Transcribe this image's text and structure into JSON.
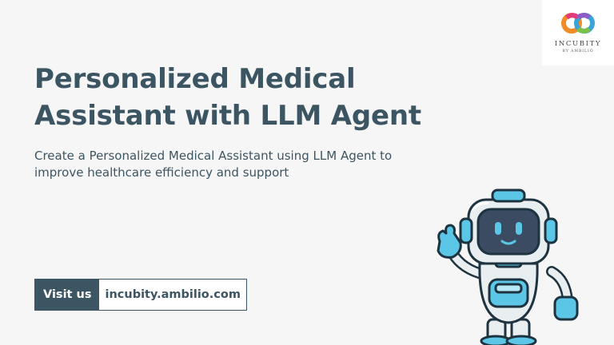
{
  "title": "Personalized Medical Assistant with LLM Agent",
  "subtitle": "Create a Personalized Medical Assistant using LLM Agent to improve healthcare efficiency and support",
  "cta": {
    "label": "Visit us",
    "url": "incubity.ambilio.com"
  },
  "logo": {
    "name": "INCUBITY",
    "tagline": "BY AMBILIO"
  },
  "illustration": {
    "name": "robot-mascot-waving-icon"
  },
  "colors": {
    "background": "#f6f6f6",
    "text": "#3c5563",
    "accent": "#5bc6e6"
  }
}
